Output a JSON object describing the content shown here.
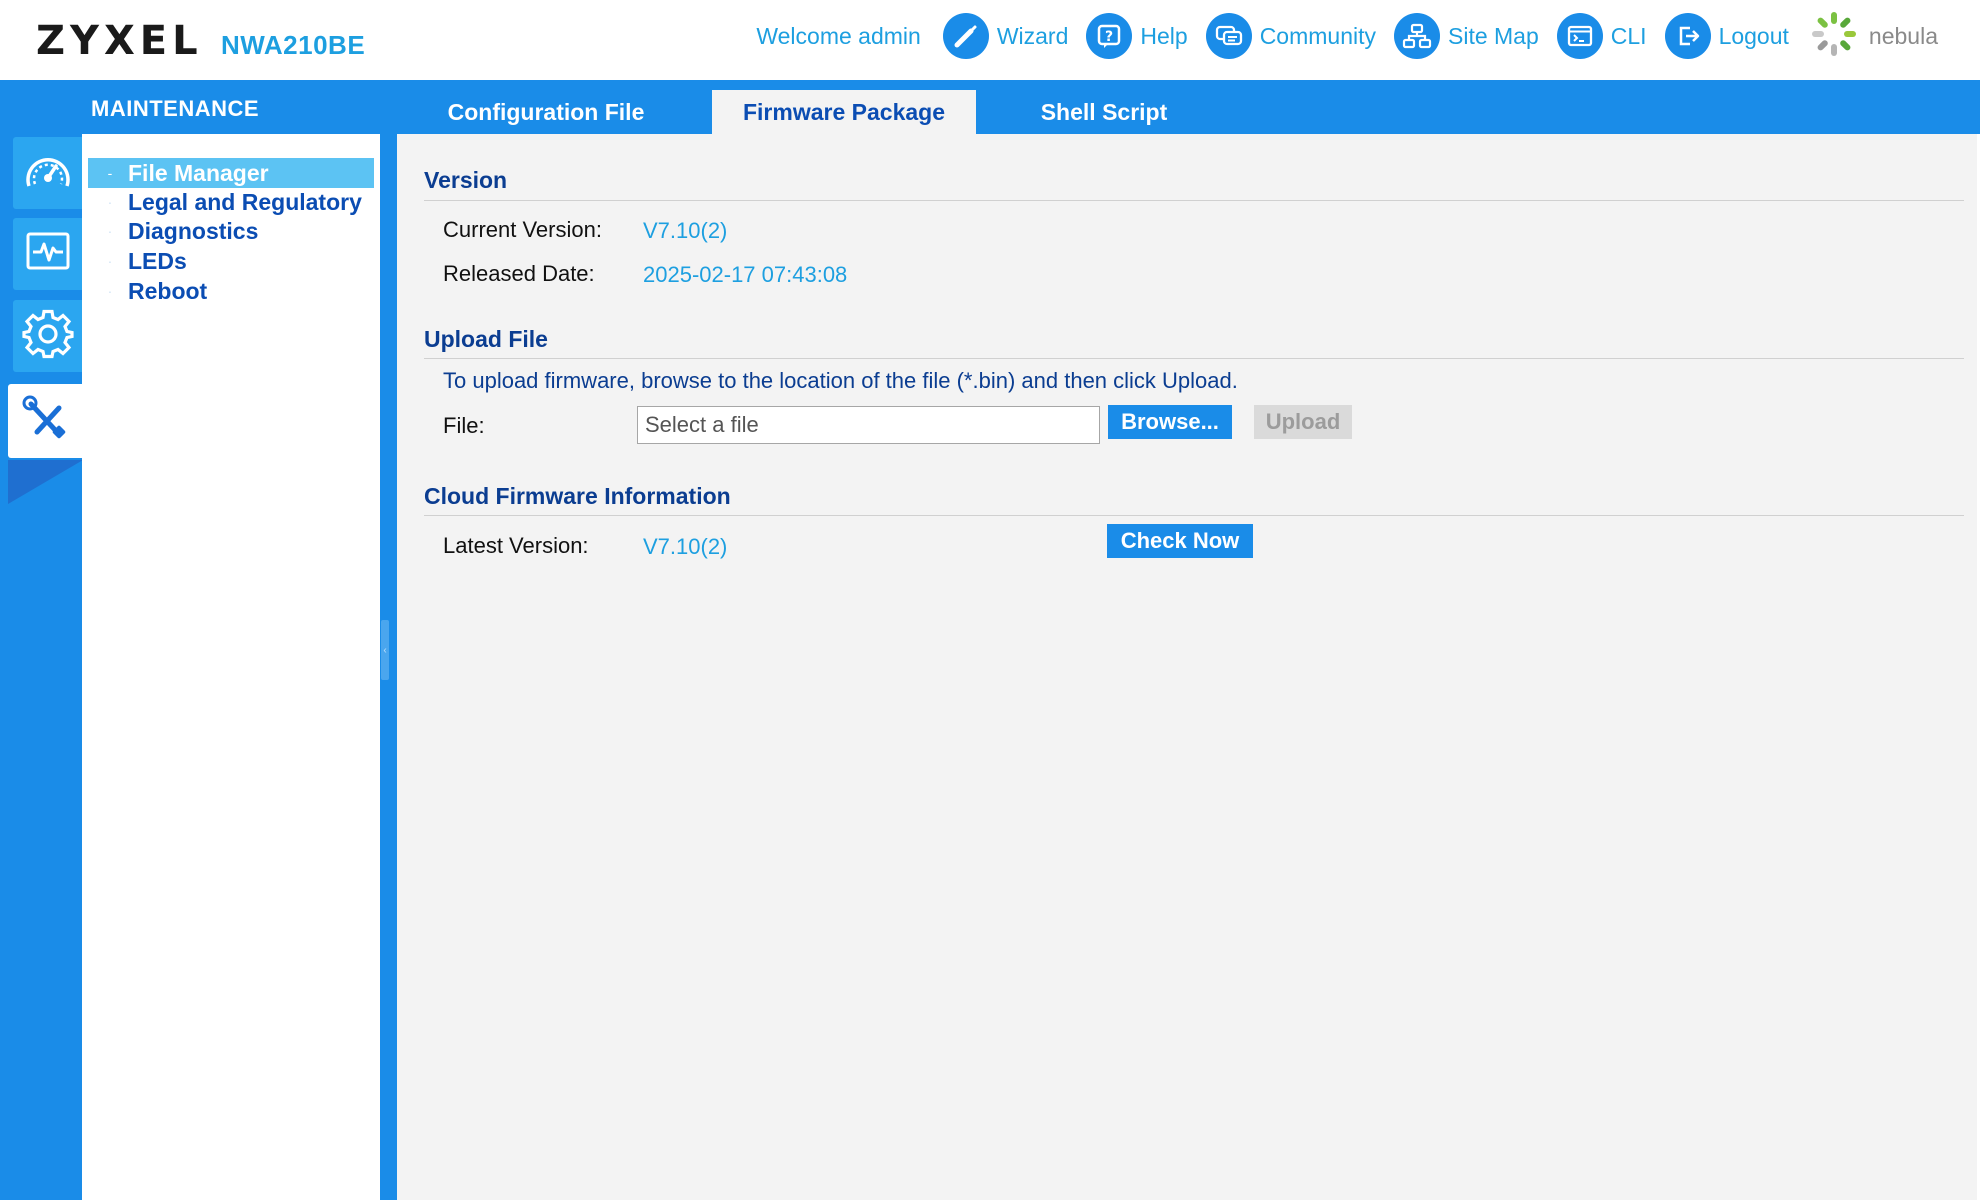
{
  "header": {
    "brand": "ZYXEL",
    "model": "NWA210BE",
    "welcome": "Welcome admin",
    "nav": [
      {
        "label": "Wizard",
        "icon": "wand-icon"
      },
      {
        "label": "Help",
        "icon": "help-icon"
      },
      {
        "label": "Community",
        "icon": "chat-icon"
      },
      {
        "label": "Site Map",
        "icon": "sitemap-icon"
      },
      {
        "label": "CLI",
        "icon": "terminal-icon"
      },
      {
        "label": "Logout",
        "icon": "logout-icon"
      }
    ],
    "nebula": "nebula"
  },
  "section_title": "MAINTENANCE",
  "tabs": [
    {
      "label": "Configuration File",
      "active": false
    },
    {
      "label": "Firmware Package",
      "active": true
    },
    {
      "label": "Shell Script",
      "active": false
    }
  ],
  "rail": [
    {
      "icon": "dashboard-icon"
    },
    {
      "icon": "monitor-icon"
    },
    {
      "icon": "configuration-icon"
    },
    {
      "icon": "maintenance-tools-icon",
      "active": true
    }
  ],
  "menu": [
    {
      "label": "File Manager",
      "active": true
    },
    {
      "label": "Legal and Regulatory"
    },
    {
      "label": "Diagnostics"
    },
    {
      "label": "LEDs"
    },
    {
      "label": "Reboot"
    }
  ],
  "version": {
    "title": "Version",
    "current_label": "Current Version:",
    "current_value": "V7.10(2)",
    "released_label": "Released Date:",
    "released_value": "2025-02-17 07:43:08"
  },
  "upload": {
    "title": "Upload File",
    "hint": "To upload firmware, browse to the location of the file (*.bin) and then click Upload.",
    "file_label": "File:",
    "file_placeholder": "Select a file",
    "browse_label": "Browse...",
    "upload_label": "Upload"
  },
  "cloud": {
    "title": "Cloud Firmware Information",
    "latest_label": "Latest Version:",
    "latest_value": "V7.10(2)",
    "check_label": "Check Now"
  },
  "colors": {
    "accent": "#1a8ce8",
    "link": "#1d9fe0",
    "heading": "#0b3d91",
    "menu_active": "#5cc3f3"
  }
}
